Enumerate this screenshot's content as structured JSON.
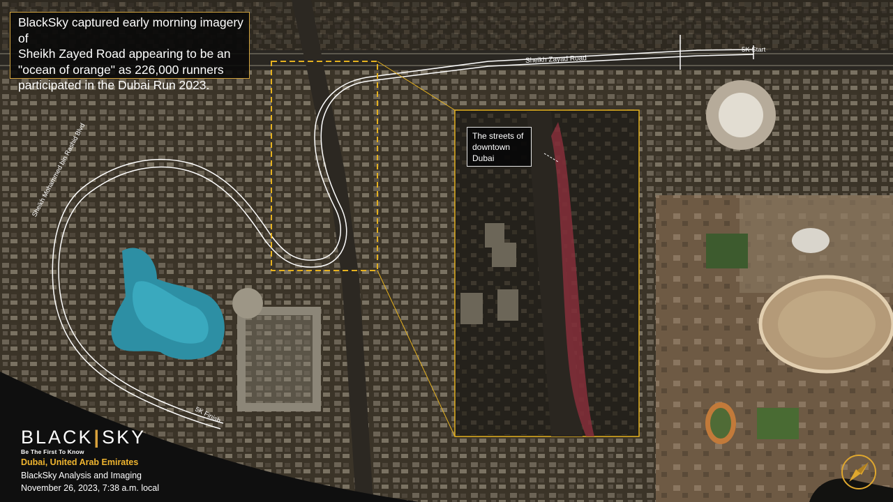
{
  "caption": {
    "lines": [
      "BlackSky captured early morning imagery of",
      "Sheikh Zayed Road appearing to be an",
      "\"ocean of orange\" as 226,000 runners",
      "participated in the Dubai Run 2023."
    ]
  },
  "inset_label": {
    "lines": [
      "The streets of",
      "downtown",
      "Dubai"
    ]
  },
  "map_labels": {
    "sheikh_zayed_road": "Sheikh Zayad Road",
    "sheikh_mohammed_blvd": "Sheikh Mohammed bin Rashid Blvd",
    "start": "5K Start",
    "finish": "5K Finish"
  },
  "brand": {
    "logo_left": "BLACK",
    "logo_slash": "|",
    "logo_right": "SKY",
    "tagline": "Be The First To Know"
  },
  "location": "Dubai, United Arab Emirates",
  "analysis": "BlackSky Analysis and Imaging",
  "date": "November 26, 2023,  7:38  a.m. local",
  "icons": [
    "compass-icon"
  ],
  "colors": {
    "accent": "#d4a640",
    "route": "#ffffff",
    "highlight_box": "#e6b21f",
    "location_text": "#f0b52f"
  }
}
